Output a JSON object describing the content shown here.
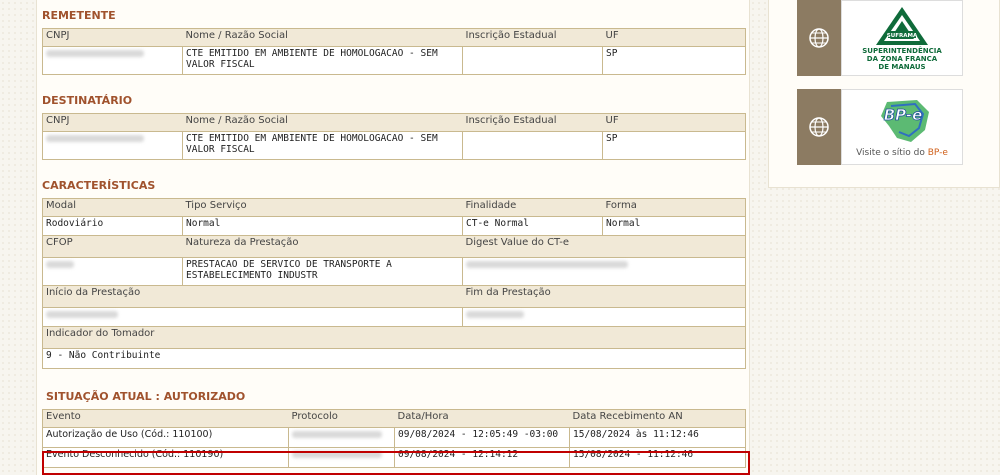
{
  "remetente": {
    "title": "REMETENTE",
    "headers": [
      "CNPJ",
      "Nome / Razão Social",
      "Inscrição Estadual",
      "UF"
    ],
    "nome": "CTE EMITIDO EM AMBIENTE DE HOMOLOGACAO - SEM VALOR FISCAL",
    "inscricao": "",
    "uf": "SP"
  },
  "destinatario": {
    "title": "DESTINATÁRIO",
    "headers": [
      "CNPJ",
      "Nome / Razão Social",
      "Inscrição Estadual",
      "UF"
    ],
    "nome": "CTE EMITIDO EM AMBIENTE DE HOMOLOGACAO - SEM VALOR FISCAL",
    "inscricao": "",
    "uf": "SP"
  },
  "caracteristicas": {
    "title": "CARACTERÍSTICAS",
    "row1_headers": [
      "Modal",
      "Tipo Serviço",
      "Finalidade",
      "Forma"
    ],
    "row1_values": [
      "Rodoviário",
      "Normal",
      "CT-e Normal",
      "Normal"
    ],
    "row2_headers": [
      "CFOP",
      "Natureza da Prestação",
      "Digest Value do CT-e"
    ],
    "natureza": "PRESTACAO DE SERVICO DE TRANSPORTE A ESTABELECIMENTO INDUSTR",
    "inicio_label": "Início da Prestação",
    "fim_label": "Fim da Prestação",
    "tomador_label": "Indicador do Tomador",
    "tomador_value": "9 - Não Contribuinte"
  },
  "situacao": {
    "title": "SITUAÇÃO ATUAL : AUTORIZADO",
    "headers": [
      "Evento",
      "Protocolo",
      "Data/Hora",
      "Data Recebimento AN"
    ],
    "rows": [
      {
        "evento": "Autorização de Uso (Cód.: 110100)",
        "data_hora": "09/08/2024 - 12:05:49  -03:00",
        "recebimento": "15/08/2024 às 11:12:46"
      },
      {
        "evento": "Evento Desconhecido (Cód.: 110190)",
        "data_hora": "09/08/2024 - 12:14:12",
        "recebimento": "15/08/2024 - 11:12:46"
      }
    ]
  },
  "sidebar": {
    "suframa_line1": "SUPERINTENDÊNCIA",
    "suframa_line2": "DA ZONA FRANCA",
    "suframa_line3": "DE MANAUS",
    "suframa_logo": "SUFRAMA",
    "bpe_logo": "BP-e",
    "bpe_prefix": "Visite o sítio do ",
    "bpe_link": "BP-e"
  },
  "colors": {
    "accent": "#a0522d",
    "table_bg": "#f1e9d7",
    "border": "#c9b98f",
    "highlight": "#c00000"
  }
}
